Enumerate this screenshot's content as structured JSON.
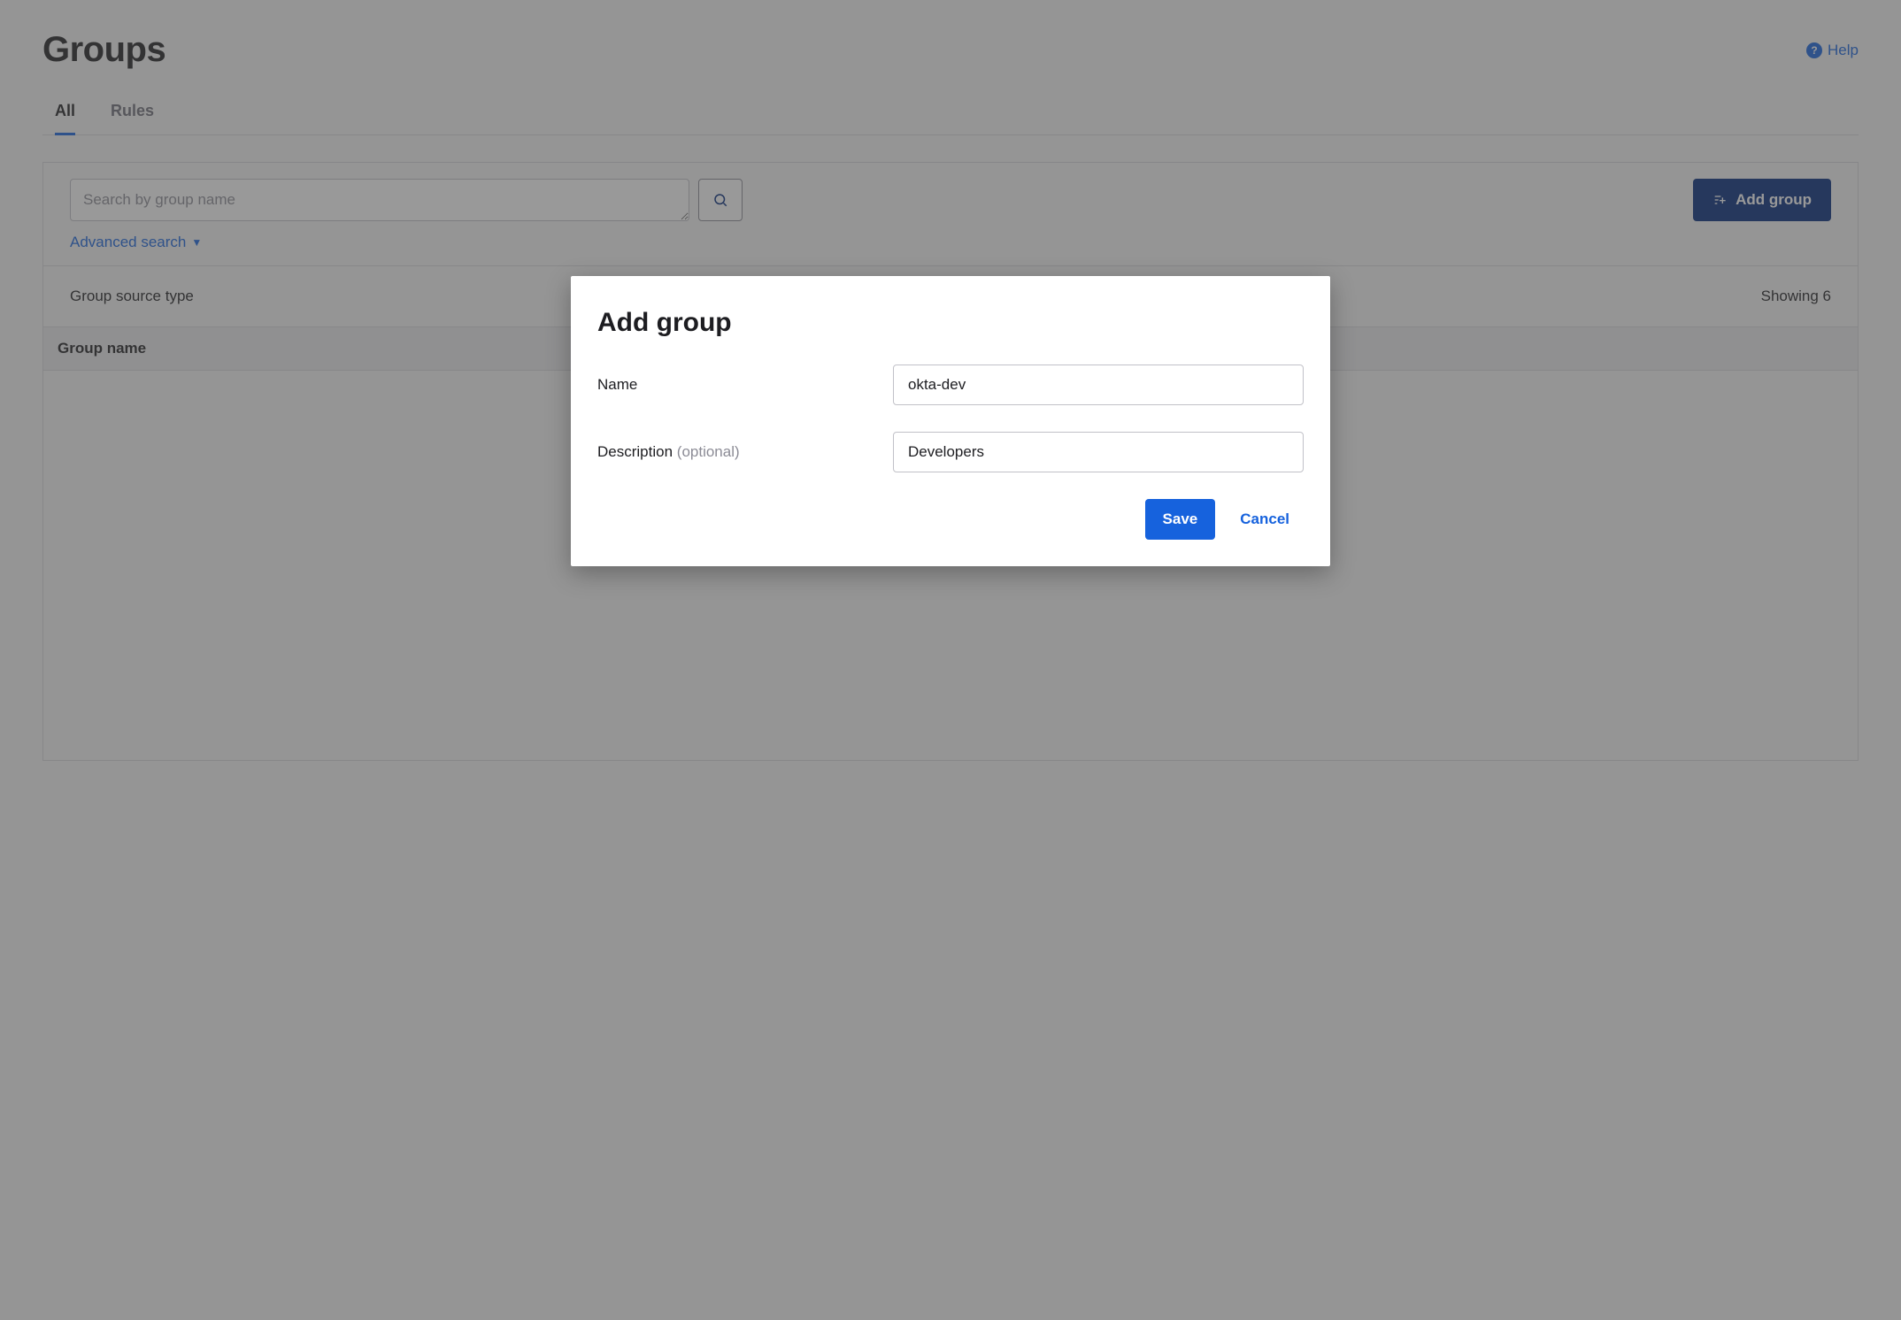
{
  "header": {
    "title": "Groups",
    "help": "Help"
  },
  "tabs": {
    "all": "All",
    "rules": "Rules"
  },
  "search": {
    "placeholder": "Search by group name",
    "advanced": "Advanced search",
    "add_group": "Add group"
  },
  "info": {
    "group_source_type": "Group source type",
    "showing": "Showing 6"
  },
  "table": {
    "col_group_name": "Group name"
  },
  "modal": {
    "title": "Add group",
    "name_label": "Name",
    "name_value": "okta-dev",
    "desc_label": "Description",
    "desc_optional": "(optional)",
    "desc_value": "Developers",
    "save": "Save",
    "cancel": "Cancel"
  }
}
